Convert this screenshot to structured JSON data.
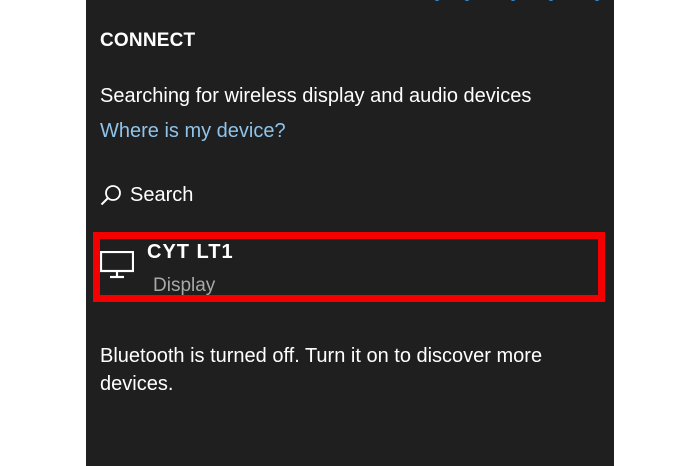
{
  "panel": {
    "title": "CONNECT",
    "status_text": "Searching for wireless display and audio devices",
    "help_link": "Where is my device?",
    "search_label": "Search",
    "search_icon": "search-icon",
    "devices": [
      {
        "name": "CYT LT1",
        "type": "Display",
        "icon": "monitor-icon"
      }
    ],
    "bluetooth_message": "Bluetooth is turned off. Turn it on to discover more devices."
  },
  "colors": {
    "panel_bg": "#1f1f1f",
    "link": "#8fc3ea",
    "secondary_text": "#a8a8a8",
    "highlight": "#f50000",
    "progress_dots": "#3a8fd8"
  }
}
